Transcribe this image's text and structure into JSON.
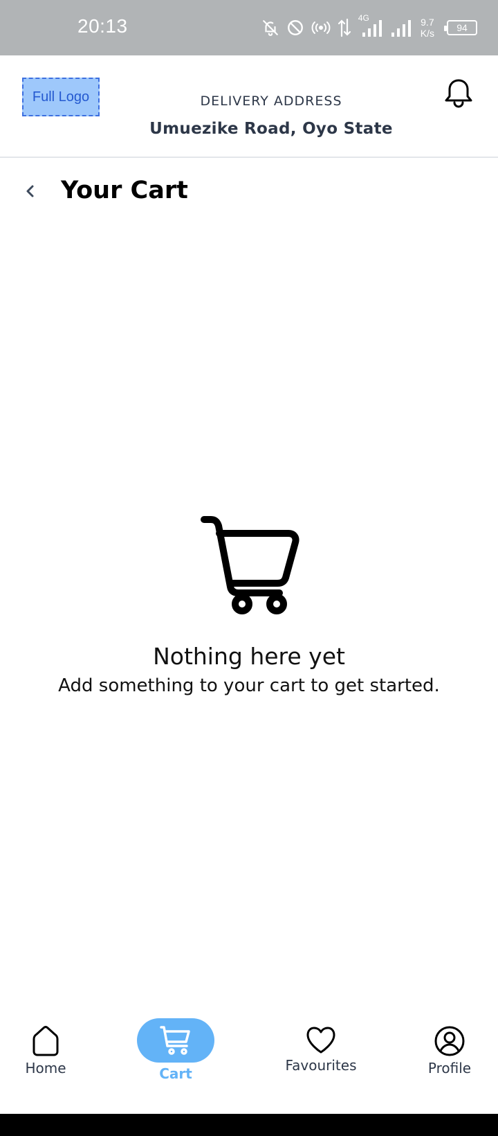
{
  "status_bar": {
    "time": "20:13",
    "network_type": "4G",
    "speed_value": "9.7",
    "speed_unit": "K/s",
    "battery": "94",
    "icons": [
      "bell-off-icon",
      "do-not-disturb-icon",
      "hotspot-icon",
      "data-arrows-icon",
      "signal-icon",
      "signal-icon-2",
      "battery-icon"
    ]
  },
  "header": {
    "logo_text": "Full Logo",
    "delivery_label": "DELIVERY ADDRESS",
    "delivery_address": "Umuezike Road, Oyo State",
    "notification_icon": "bell-icon"
  },
  "page": {
    "title": "Your Cart",
    "back_icon": "chevron-left-icon"
  },
  "empty_state": {
    "icon": "shopping-cart-icon",
    "title": "Nothing here yet",
    "subtitle": "Add something to your cart to get started."
  },
  "bottom_nav": {
    "items": [
      {
        "label": "Home",
        "icon": "home-icon",
        "active": false
      },
      {
        "label": "Cart",
        "icon": "cart-icon",
        "active": true
      },
      {
        "label": "Favourites",
        "icon": "heart-icon",
        "active": false
      },
      {
        "label": "Profile",
        "icon": "profile-icon",
        "active": false
      }
    ]
  },
  "colors": {
    "accent": "#63b3f7",
    "status_bar": "#b1b4b6",
    "text_secondary": "#2d3748"
  }
}
